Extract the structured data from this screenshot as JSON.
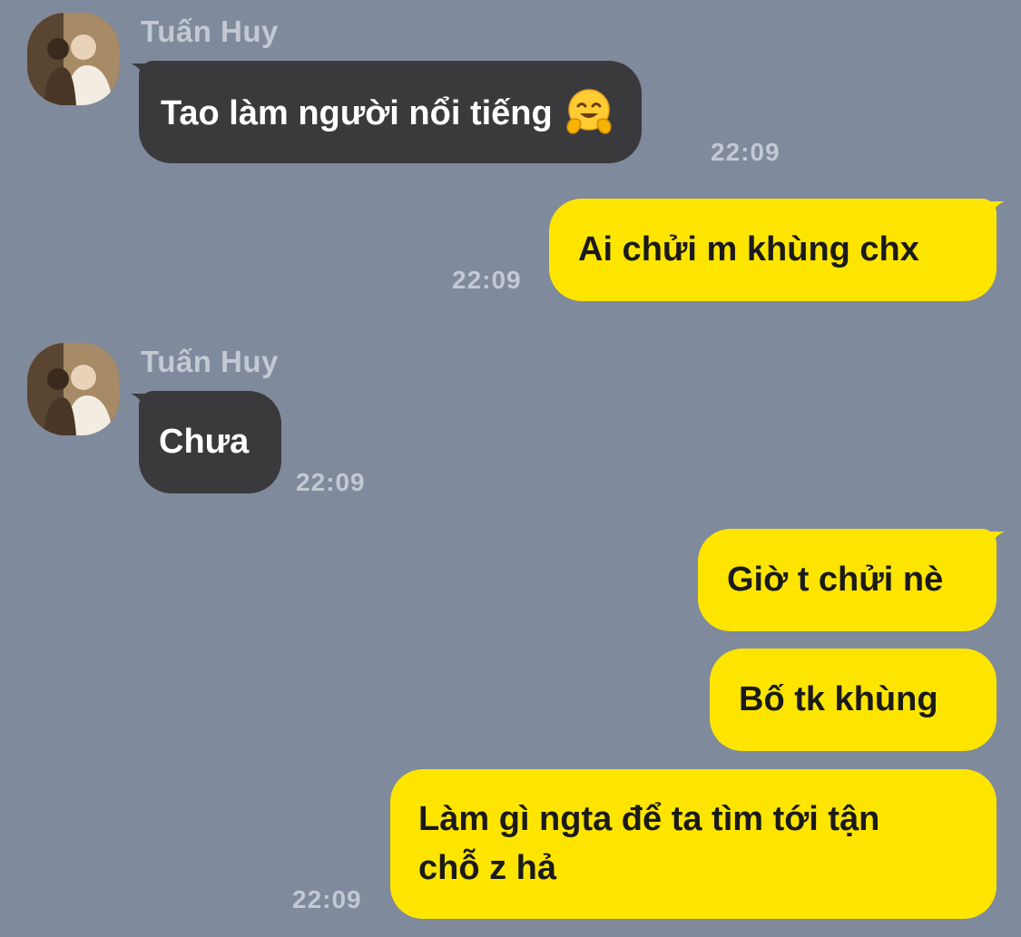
{
  "colors": {
    "background": "#7f8a9c",
    "incoming_bubble": "#3a3a3c",
    "outgoing_bubble": "#fee500",
    "meta_text": "#c3c9d3"
  },
  "messages": [
    {
      "direction": "incoming",
      "sender": "Tuấn Huy",
      "text": "Tao làm người nổi tiếng",
      "emoji": "hugging-face-emoji",
      "time": "22:09"
    },
    {
      "direction": "outgoing",
      "text": "Ai chửi m khùng chx",
      "time": "22:09"
    },
    {
      "direction": "incoming",
      "sender": "Tuấn Huy",
      "text": "Chưa",
      "time": "22:09"
    },
    {
      "direction": "outgoing",
      "text": "Giờ t chửi nè"
    },
    {
      "direction": "outgoing",
      "text": "Bố tk khùng"
    },
    {
      "direction": "outgoing",
      "text_line1": "Làm gì ngta để ta tìm tới tận",
      "text_line2": "chỗ z hả",
      "time": "22:09"
    }
  ]
}
